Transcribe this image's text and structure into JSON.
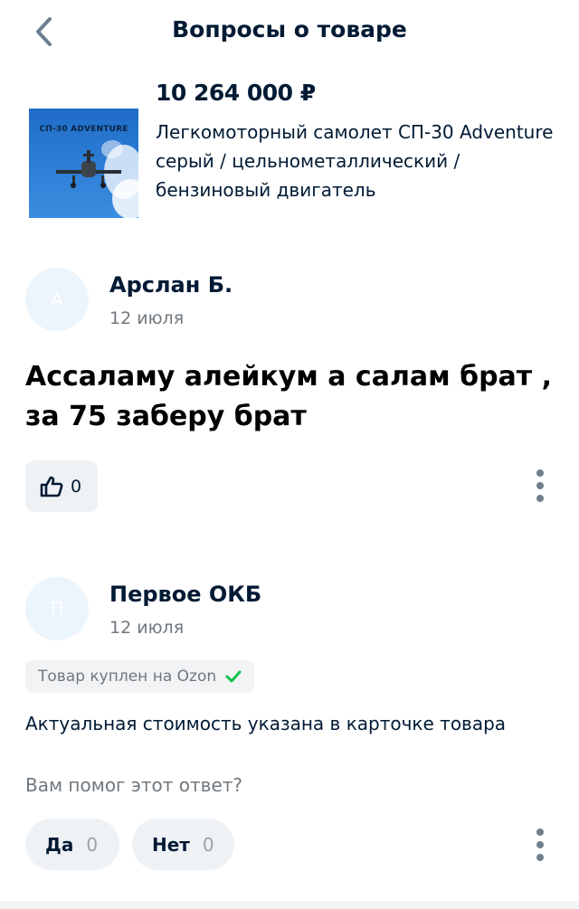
{
  "header": {
    "title": "Вопросы о товаре"
  },
  "product": {
    "price": "10 264 000 ₽",
    "description": "Легкомоторный самолет СП-30 Adventure серый / цельнометаллический / бензиновый двигатель",
    "image_text": "СП-30 ADVENTURE"
  },
  "question": {
    "avatar_letter": "А",
    "author": "Арслан Б.",
    "date": "12 июля",
    "text": "Ассаламу алейкум а салам брат , за 75 заберу брат",
    "likes": "0"
  },
  "answer": {
    "avatar_letter": "П",
    "author": "Первое ОКБ",
    "date": "12 июля",
    "badge": "Товар куплен на Ozon",
    "text": "Актуальная стоимость указана в карточке товара",
    "helpful_prompt": "Вам помог этот ответ?",
    "yes_label": "Да",
    "yes_count": "0",
    "no_label": "Нет",
    "no_count": "0"
  },
  "colors": {
    "accent_check": "#10c44c",
    "text_primary": "#001a34",
    "text_secondary": "#70787f"
  },
  "icons": [
    "back-arrow-icon",
    "thumbs-up-icon",
    "more-vertical-icon",
    "check-icon"
  ]
}
